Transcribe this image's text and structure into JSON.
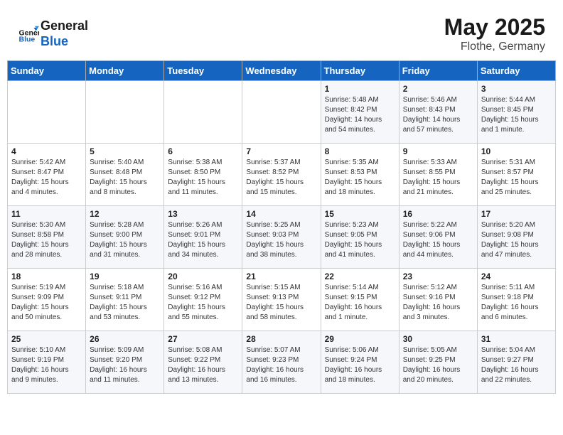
{
  "header": {
    "logo_line1": "General",
    "logo_line2": "Blue",
    "title": "May 2025",
    "subtitle": "Flothe, Germany"
  },
  "weekdays": [
    "Sunday",
    "Monday",
    "Tuesday",
    "Wednesday",
    "Thursday",
    "Friday",
    "Saturday"
  ],
  "weeks": [
    [
      {
        "day": "",
        "text": ""
      },
      {
        "day": "",
        "text": ""
      },
      {
        "day": "",
        "text": ""
      },
      {
        "day": "",
        "text": ""
      },
      {
        "day": "1",
        "text": "Sunrise: 5:48 AM\nSunset: 8:42 PM\nDaylight: 14 hours\nand 54 minutes."
      },
      {
        "day": "2",
        "text": "Sunrise: 5:46 AM\nSunset: 8:43 PM\nDaylight: 14 hours\nand 57 minutes."
      },
      {
        "day": "3",
        "text": "Sunrise: 5:44 AM\nSunset: 8:45 PM\nDaylight: 15 hours\nand 1 minute."
      }
    ],
    [
      {
        "day": "4",
        "text": "Sunrise: 5:42 AM\nSunset: 8:47 PM\nDaylight: 15 hours\nand 4 minutes."
      },
      {
        "day": "5",
        "text": "Sunrise: 5:40 AM\nSunset: 8:48 PM\nDaylight: 15 hours\nand 8 minutes."
      },
      {
        "day": "6",
        "text": "Sunrise: 5:38 AM\nSunset: 8:50 PM\nDaylight: 15 hours\nand 11 minutes."
      },
      {
        "day": "7",
        "text": "Sunrise: 5:37 AM\nSunset: 8:52 PM\nDaylight: 15 hours\nand 15 minutes."
      },
      {
        "day": "8",
        "text": "Sunrise: 5:35 AM\nSunset: 8:53 PM\nDaylight: 15 hours\nand 18 minutes."
      },
      {
        "day": "9",
        "text": "Sunrise: 5:33 AM\nSunset: 8:55 PM\nDaylight: 15 hours\nand 21 minutes."
      },
      {
        "day": "10",
        "text": "Sunrise: 5:31 AM\nSunset: 8:57 PM\nDaylight: 15 hours\nand 25 minutes."
      }
    ],
    [
      {
        "day": "11",
        "text": "Sunrise: 5:30 AM\nSunset: 8:58 PM\nDaylight: 15 hours\nand 28 minutes."
      },
      {
        "day": "12",
        "text": "Sunrise: 5:28 AM\nSunset: 9:00 PM\nDaylight: 15 hours\nand 31 minutes."
      },
      {
        "day": "13",
        "text": "Sunrise: 5:26 AM\nSunset: 9:01 PM\nDaylight: 15 hours\nand 34 minutes."
      },
      {
        "day": "14",
        "text": "Sunrise: 5:25 AM\nSunset: 9:03 PM\nDaylight: 15 hours\nand 38 minutes."
      },
      {
        "day": "15",
        "text": "Sunrise: 5:23 AM\nSunset: 9:05 PM\nDaylight: 15 hours\nand 41 minutes."
      },
      {
        "day": "16",
        "text": "Sunrise: 5:22 AM\nSunset: 9:06 PM\nDaylight: 15 hours\nand 44 minutes."
      },
      {
        "day": "17",
        "text": "Sunrise: 5:20 AM\nSunset: 9:08 PM\nDaylight: 15 hours\nand 47 minutes."
      }
    ],
    [
      {
        "day": "18",
        "text": "Sunrise: 5:19 AM\nSunset: 9:09 PM\nDaylight: 15 hours\nand 50 minutes."
      },
      {
        "day": "19",
        "text": "Sunrise: 5:18 AM\nSunset: 9:11 PM\nDaylight: 15 hours\nand 53 minutes."
      },
      {
        "day": "20",
        "text": "Sunrise: 5:16 AM\nSunset: 9:12 PM\nDaylight: 15 hours\nand 55 minutes."
      },
      {
        "day": "21",
        "text": "Sunrise: 5:15 AM\nSunset: 9:13 PM\nDaylight: 15 hours\nand 58 minutes."
      },
      {
        "day": "22",
        "text": "Sunrise: 5:14 AM\nSunset: 9:15 PM\nDaylight: 16 hours\nand 1 minute."
      },
      {
        "day": "23",
        "text": "Sunrise: 5:12 AM\nSunset: 9:16 PM\nDaylight: 16 hours\nand 3 minutes."
      },
      {
        "day": "24",
        "text": "Sunrise: 5:11 AM\nSunset: 9:18 PM\nDaylight: 16 hours\nand 6 minutes."
      }
    ],
    [
      {
        "day": "25",
        "text": "Sunrise: 5:10 AM\nSunset: 9:19 PM\nDaylight: 16 hours\nand 9 minutes."
      },
      {
        "day": "26",
        "text": "Sunrise: 5:09 AM\nSunset: 9:20 PM\nDaylight: 16 hours\nand 11 minutes."
      },
      {
        "day": "27",
        "text": "Sunrise: 5:08 AM\nSunset: 9:22 PM\nDaylight: 16 hours\nand 13 minutes."
      },
      {
        "day": "28",
        "text": "Sunrise: 5:07 AM\nSunset: 9:23 PM\nDaylight: 16 hours\nand 16 minutes."
      },
      {
        "day": "29",
        "text": "Sunrise: 5:06 AM\nSunset: 9:24 PM\nDaylight: 16 hours\nand 18 minutes."
      },
      {
        "day": "30",
        "text": "Sunrise: 5:05 AM\nSunset: 9:25 PM\nDaylight: 16 hours\nand 20 minutes."
      },
      {
        "day": "31",
        "text": "Sunrise: 5:04 AM\nSunset: 9:27 PM\nDaylight: 16 hours\nand 22 minutes."
      }
    ]
  ]
}
